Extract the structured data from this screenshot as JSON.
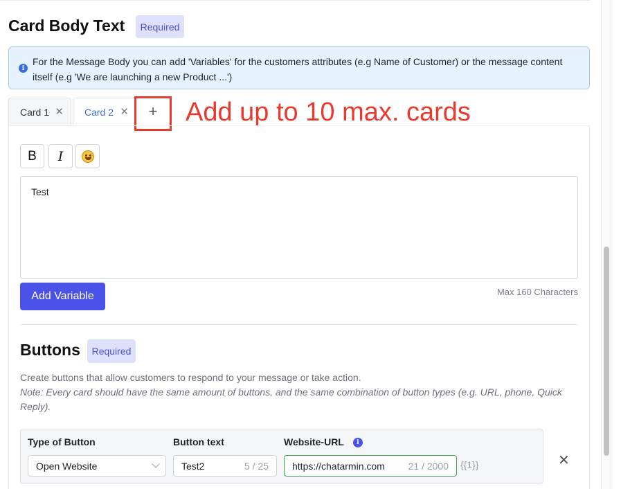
{
  "card_body": {
    "title": "Card Body Text",
    "required_badge": "Required",
    "info_text": "For the Message Body you can add 'Variables' for the customers attributes (e.g Name of Customer) or the message content itself (e.g 'We are launching a new Product ...')"
  },
  "tabs": [
    {
      "label": "Card 1",
      "active": false
    },
    {
      "label": "Card 2",
      "active": true
    }
  ],
  "tab_close_glyph": "✕",
  "tab_add_glyph": "+",
  "annotation": "Add up to 10 max. cards",
  "annotation_color": "#e63b2e",
  "toolbar": {
    "bold": "B",
    "italic": "I",
    "emoji_icon": "smiley-emoji-icon"
  },
  "editor": {
    "value": "Test",
    "max_note": "Max 160 Characters",
    "add_variable_label": "Add Variable"
  },
  "buttons_section": {
    "title": "Buttons",
    "required_badge": "Required",
    "description": "Create buttons that allow customers to respond to your message or take action.",
    "note": "Note: Every card should have the same amount of buttons, and the same combination of button types (e.g. URL, phone, Quick Reply).",
    "row": {
      "type_label": "Type of Button",
      "type_value": "Open Website",
      "text_label": "Button text",
      "text_value": "Test2",
      "text_counter": "5 / 25",
      "url_label": "Website-URL",
      "url_value": "https://chatarmin.com",
      "url_counter": "21 / 2000",
      "variable_hint": "{{1}}",
      "remove_glyph": "✕"
    }
  },
  "colors": {
    "accent": "#4a52e8",
    "tab_active": "#3b6fe0",
    "info_bg": "#e6f2fd",
    "valid_border": "#3aa34a"
  }
}
